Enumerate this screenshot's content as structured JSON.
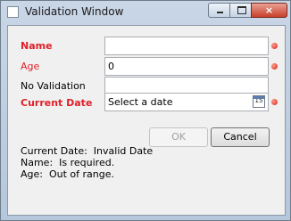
{
  "window": {
    "title": "Validation Window",
    "close_glyph": "×"
  },
  "form": {
    "name": {
      "label": "Name",
      "value": ""
    },
    "age": {
      "label": "Age",
      "value": "0"
    },
    "no_validation": {
      "label": "No Validation",
      "value": ""
    },
    "current_date": {
      "label": "Current Date",
      "placeholder": "Select a date",
      "calendar_day": "15"
    }
  },
  "buttons": {
    "ok": "OK",
    "cancel": "Cancel"
  },
  "summary": [
    "Current Date:  Invalid Date",
    "Name:  Is required.",
    "Age:  Out of range."
  ],
  "colors": {
    "error_label": "#e0202a",
    "error_dot": "#d52418",
    "close_button": "#c9402a"
  }
}
